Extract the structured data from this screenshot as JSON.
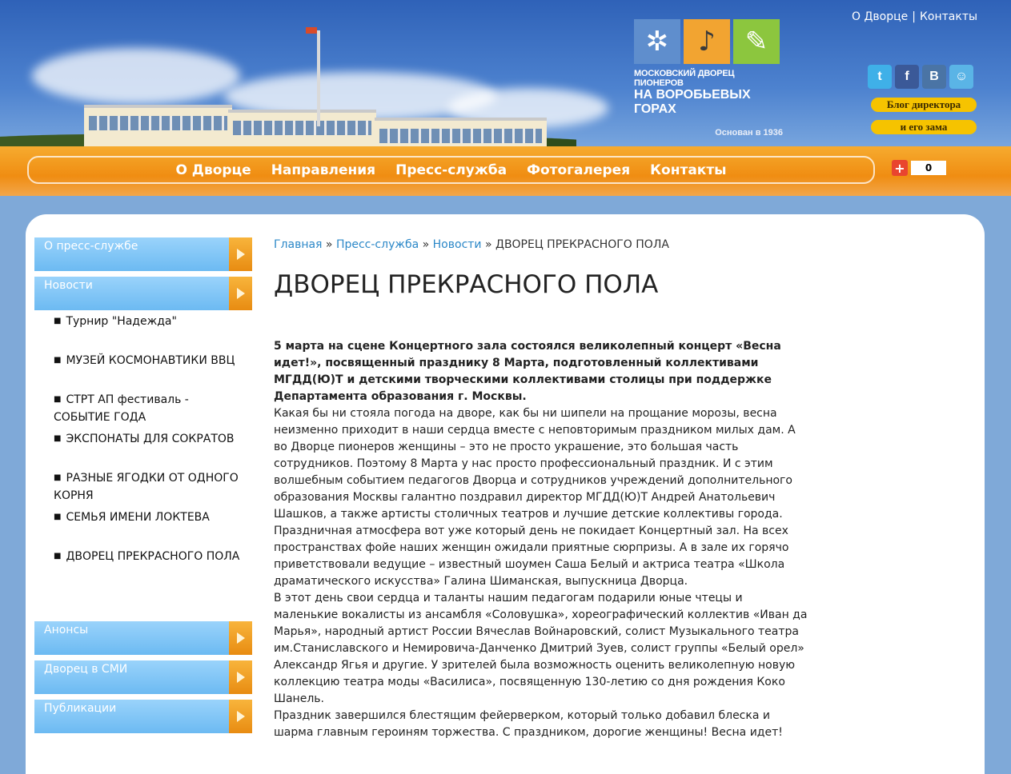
{
  "header": {
    "logo": {
      "line1": "МОСКОВСКИЙ ДВОРЕЦ ПИОНЕРОВ",
      "line2": "НА ВОРОБЬЕВЫХ ГОРАХ",
      "line3": "Основан в 1936"
    },
    "top_links": [
      {
        "label": "О Дворце"
      },
      {
        "label": "Контакты"
      }
    ],
    "top_links_sep": "|",
    "social": [
      {
        "icon": "twitter-icon",
        "glyph": "t",
        "color": "#3fb0e8"
      },
      {
        "icon": "facebook-icon",
        "glyph": "f",
        "color": "#3b5998"
      },
      {
        "icon": "vkontakte-icon",
        "glyph": "В",
        "color": "#4a74a5"
      },
      {
        "icon": "chat-icon",
        "glyph": "☺",
        "color": "#5ab4e6"
      }
    ],
    "blog_line1": "Блог директора",
    "blog_line2": "и его зама"
  },
  "nav": {
    "items": [
      "О Дворце",
      "Направления",
      "Пресс-служба",
      "Фотогалерея",
      "Контакты"
    ],
    "share_plus": "+",
    "share_count": "0"
  },
  "sidebar": {
    "sections_top": [
      {
        "label": "О пресс-службе"
      },
      {
        "label": "Новости"
      }
    ],
    "news_items": [
      {
        "label": "Турнир \"Надежда\""
      },
      {
        "label": "МУЗЕЙ КОСМОНАВТИКИ ВВЦ"
      },
      {
        "label": "СТРТ АП фестиваль - СОБЫТИЕ ГОДА"
      },
      {
        "label": "ЭКСПОНАТЫ ДЛЯ СОКРАТОВ"
      },
      {
        "label": "РАЗНЫЕ ЯГОДКИ ОТ ОДНОГО КОРНЯ"
      },
      {
        "label": "СЕМЬЯ ИМЕНИ ЛОКТЕВА"
      },
      {
        "label": "ДВОРЕЦ ПРЕКРАСНОГО ПОЛА"
      }
    ],
    "sections_bottom": [
      {
        "label": "Анонсы"
      },
      {
        "label": "Дворец в СМИ"
      },
      {
        "label": "Публикации"
      }
    ],
    "bullet": "■"
  },
  "breadcrumb": {
    "items": [
      "Главная",
      "Пресс-служба",
      "Новости"
    ],
    "current": "ДВОРЕЦ ПРЕКРАСНОГО ПОЛА",
    "sep": " » "
  },
  "article": {
    "title": "ДВОРЕЦ ПРЕКРАСНОГО ПОЛА",
    "lead": "5 марта на сцене Концертного зала состоялся великолепный концерт «Весна идет!», посвященный празднику 8 Марта, подготовленный коллективами МГДД(Ю)Т и детскими творческими коллективами столицы при поддержке Департамента образования г. Москвы.",
    "paragraphs": [
      "Какая бы ни стояла погода на дворе, как бы ни шипели на прощание морозы, весна неизменно приходит в наши сердца вместе с неповторимым праздником милых дам. А во Дворце пионеров женщины – это не просто украшение, это большая часть сотрудников. Поэтому 8 Марта у нас просто профессиональный праздник. И с этим волшебным событием педагогов Дворца и сотрудников учреждений дополнительного образования Москвы галантно поздравил директор МГДД(Ю)Т Андрей Анатольевич Шашков, а также артисты столичных театров и лучшие детские коллективы города.",
      "Праздничная атмосфера вот уже который день не покидает Концертный зал. На всех пространствах фойе наших женщин ожидали приятные сюрпризы. А в зале их горячо приветствовали ведущие – известный шоумен Саша Белый и актриса театра «Школа драматического искусства» Галина Шиманская, выпускница Дворца.",
      "В этот день свои сердца и таланты нашим педагогам подарили юные чтецы и маленькие вокалисты из ансамбля «Соловушка», хореографический коллектив «Иван да Марья», народный артист России Вячеслав Войнаровский, солист Музыкального театра им.Станиславского и Немировича-Данченко Дмитрий Зуев, солист группы «Белый орел» Александр Ягья и другие. У зрителей была возможность оценить великолепную новую коллекцию театра моды «Василиса», посвященную 130-летию со дня рождения Коко Шанель.",
      "Праздник завершился блестящим фейерверком, который только добавил блеска и шарма главным героиням торжества. С праздником, дорогие женщины! Весна идет!"
    ]
  }
}
